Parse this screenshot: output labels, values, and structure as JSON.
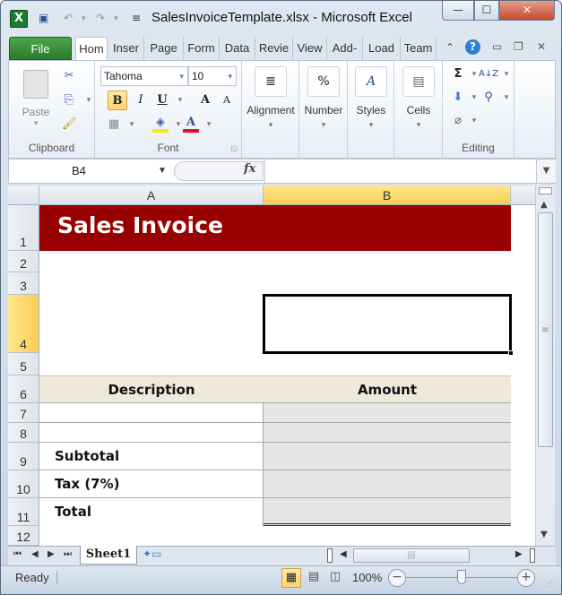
{
  "window": {
    "title": "SalesInvoiceTemplate.xlsx  -  Microsoft Excel",
    "controls": {
      "minimize": "—",
      "maximize": "☐",
      "close": "✕"
    }
  },
  "quick_access": {
    "save_icon": "💾",
    "undo_icon": "↶",
    "redo_icon": "↷",
    "dropdown": "▾",
    "customize": "≡"
  },
  "tabs": [
    {
      "label": "File"
    },
    {
      "label": "Hom"
    },
    {
      "label": "Inser"
    },
    {
      "label": "Page"
    },
    {
      "label": "Form"
    },
    {
      "label": "Data"
    },
    {
      "label": "Revie"
    },
    {
      "label": "View"
    },
    {
      "label": "Add-"
    },
    {
      "label": "Load"
    },
    {
      "label": "Team"
    }
  ],
  "ribbon_right_icons": {
    "collapse": "⌃",
    "help": "?",
    "min": "▭",
    "restore": "❐",
    "close": "✕"
  },
  "ribbon": {
    "clipboard": {
      "label": "Clipboard",
      "paste": "Paste"
    },
    "font": {
      "label": "Font",
      "font_name": "Tahoma",
      "font_size": "10",
      "bold": "B",
      "italic": "I",
      "underline": "U",
      "grow": "A",
      "shrink": "A",
      "font_color": "A",
      "fill_color": "#f5ea14",
      "text_color": "#e2131b"
    },
    "alignment": {
      "label": "Alignment"
    },
    "number": {
      "label": "Number",
      "icon": "%"
    },
    "styles": {
      "label": "Styles"
    },
    "cells": {
      "label": "Cells"
    },
    "editing": {
      "label": "Editing",
      "sum": "Σ",
      "sort": "A↓Z",
      "find": "🔍",
      "clear": "⌫"
    }
  },
  "formula_bar": {
    "name_box": "B4",
    "fx": "fx",
    "formula": ""
  },
  "sheet": {
    "columns": [
      "A",
      "B"
    ],
    "selected_column": "B",
    "rows": [
      "1",
      "2",
      "3",
      "4",
      "5",
      "6",
      "7",
      "8",
      "9",
      "10",
      "11",
      "12"
    ],
    "selected_row": "4",
    "title": "Sales Invoice",
    "title_bg": "#990000",
    "header_bg": "#efe9dc",
    "amount_bg": "#e6e6e6",
    "headers": {
      "description": "Description",
      "amount": "Amount"
    },
    "labels": {
      "subtotal": "Subtotal",
      "tax": "Tax (7%)",
      "total": "Total"
    }
  },
  "sheet_tabs": {
    "active": "Sheet1"
  },
  "status": {
    "ready": "Ready",
    "zoom": "100%",
    "zoom_fraction": 0.5
  }
}
